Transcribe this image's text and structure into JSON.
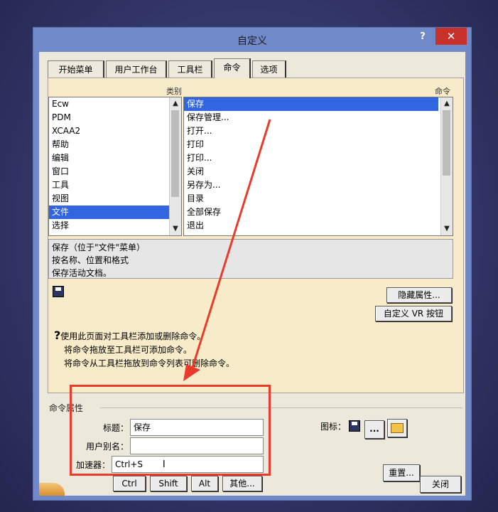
{
  "window": {
    "title": "自定义",
    "help_label": "?",
    "close_label": "✕"
  },
  "tabs": [
    {
      "label": "开始菜单"
    },
    {
      "label": "用户工作台"
    },
    {
      "label": "工具栏"
    },
    {
      "label": "命令",
      "active": true
    },
    {
      "label": "选项"
    }
  ],
  "categories": {
    "header": "类别",
    "items": [
      "Ecw",
      "PDM",
      "XCAA2",
      "帮助",
      "编辑",
      "窗口",
      "工具",
      "视图",
      "文件",
      "选择"
    ],
    "selected": "文件"
  },
  "commands": {
    "header": "命令",
    "items": [
      "保存",
      "保存管理...",
      "打开...",
      "打印",
      "打印...",
      "关闭",
      "另存为...",
      "目录",
      "全部保存",
      "退出"
    ],
    "selected": "保存"
  },
  "description": {
    "line1": "保存（位于\"文件\"菜单）",
    "line2": "按名称、位置和格式",
    "line3": "保存活动文档。"
  },
  "buttons": {
    "hide_props": "隐藏属性...",
    "vr_button": "自定义 VR 按钮",
    "reset": "重置...",
    "close": "关闭",
    "icon_more": "..."
  },
  "help": {
    "line1": "使用此页面对工具栏添加或删除命令。",
    "line2": "将命令拖放至工具栏可添加命令。",
    "line3": "将命令从工具栏拖放到命令列表可删除命令。"
  },
  "props": {
    "section_title": "命令属性",
    "title_label": "标题：",
    "title_value": "保存",
    "alias_label": "用户别名：",
    "alias_value": "",
    "accel_label": "加速器：",
    "accel_value": "Ctrl+S",
    "icon_label": "图标：",
    "mod_ctrl": "Ctrl",
    "mod_shift": "Shift",
    "mod_alt": "Alt",
    "mod_other": "其他..."
  },
  "colors": {
    "highlight": "#3166e0",
    "annotation": "#e83b2b",
    "close": "#c7312a"
  }
}
